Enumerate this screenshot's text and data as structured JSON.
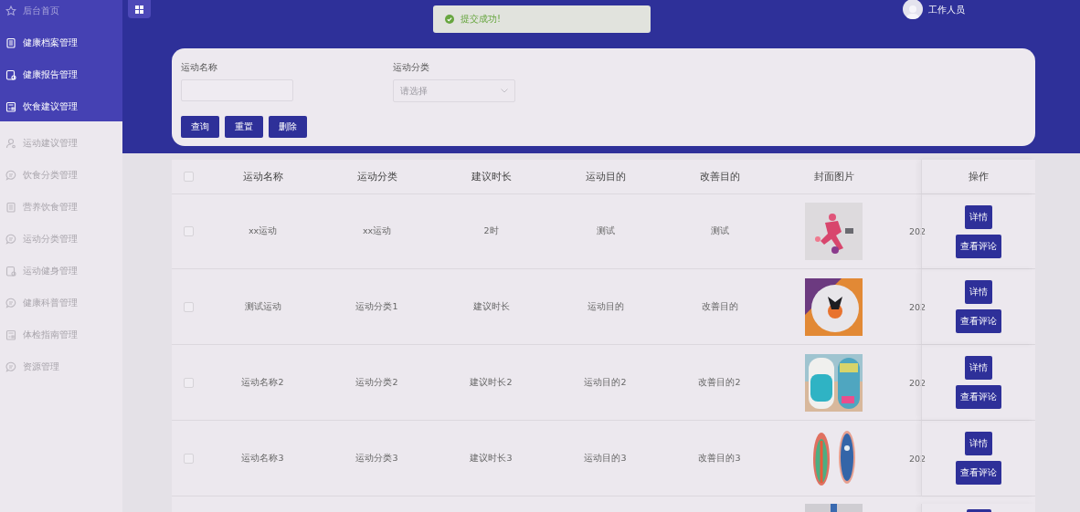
{
  "sidebar": {
    "top_items": [
      {
        "label": "后台首页",
        "kind": "star",
        "muted": true
      },
      {
        "label": "健康档案管理",
        "kind": "clipboard",
        "muted": false
      },
      {
        "label": "健康报告管理",
        "kind": "doc-check",
        "muted": false
      },
      {
        "label": "饮食建议管理",
        "kind": "doc-grid",
        "muted": false
      }
    ],
    "items": [
      {
        "label": "运动建议管理",
        "kind": "person"
      },
      {
        "label": "饮食分类管理",
        "kind": "chat"
      },
      {
        "label": "营养饮食管理",
        "kind": "clipboard"
      },
      {
        "label": "运动分类管理",
        "kind": "chat"
      },
      {
        "label": "运动健身管理",
        "kind": "doc-check"
      },
      {
        "label": "健康科普管理",
        "kind": "chat"
      },
      {
        "label": "体检指南管理",
        "kind": "doc-grid"
      },
      {
        "label": "资源管理",
        "kind": "chat"
      }
    ]
  },
  "header": {
    "user": "工作人员"
  },
  "toast": {
    "message": "提交成功!"
  },
  "search": {
    "fields": [
      {
        "label": "运动名称",
        "kind": "input"
      },
      {
        "label": "运动分类",
        "kind": "select",
        "placeholder": "请选择"
      }
    ],
    "buttons": [
      "查询",
      "重置",
      "删除"
    ]
  },
  "table": {
    "header_checked": false,
    "columns": [
      "运动名称",
      "运动分类",
      "建议时长",
      "运动目的",
      "改善目的",
      "封面图片",
      "操作"
    ],
    "rows": [
      {
        "checked": false,
        "cells": [
          "xx运动",
          "xx运动",
          "2时",
          "测试",
          "测试"
        ],
        "date": "202",
        "actions": [
          "详情",
          "查看评论"
        ]
      },
      {
        "checked": false,
        "cells": [
          "测试运动",
          "运动分类1",
          "建议时长",
          "运动目的",
          "改善目的"
        ],
        "date": "202",
        "actions": [
          "详情",
          "查看评论"
        ]
      },
      {
        "checked": false,
        "cells": [
          "运动名称2",
          "运动分类2",
          "建议时长2",
          "运动目的2",
          "改善目的2"
        ],
        "date": "202",
        "actions": [
          "详情",
          "查看评论"
        ]
      },
      {
        "checked": false,
        "cells": [
          "运动名称3",
          "运动分类3",
          "建议时长3",
          "运动目的3",
          "改善目的3"
        ],
        "date": "202",
        "actions": [
          "详情",
          "查看评论"
        ]
      }
    ]
  }
}
